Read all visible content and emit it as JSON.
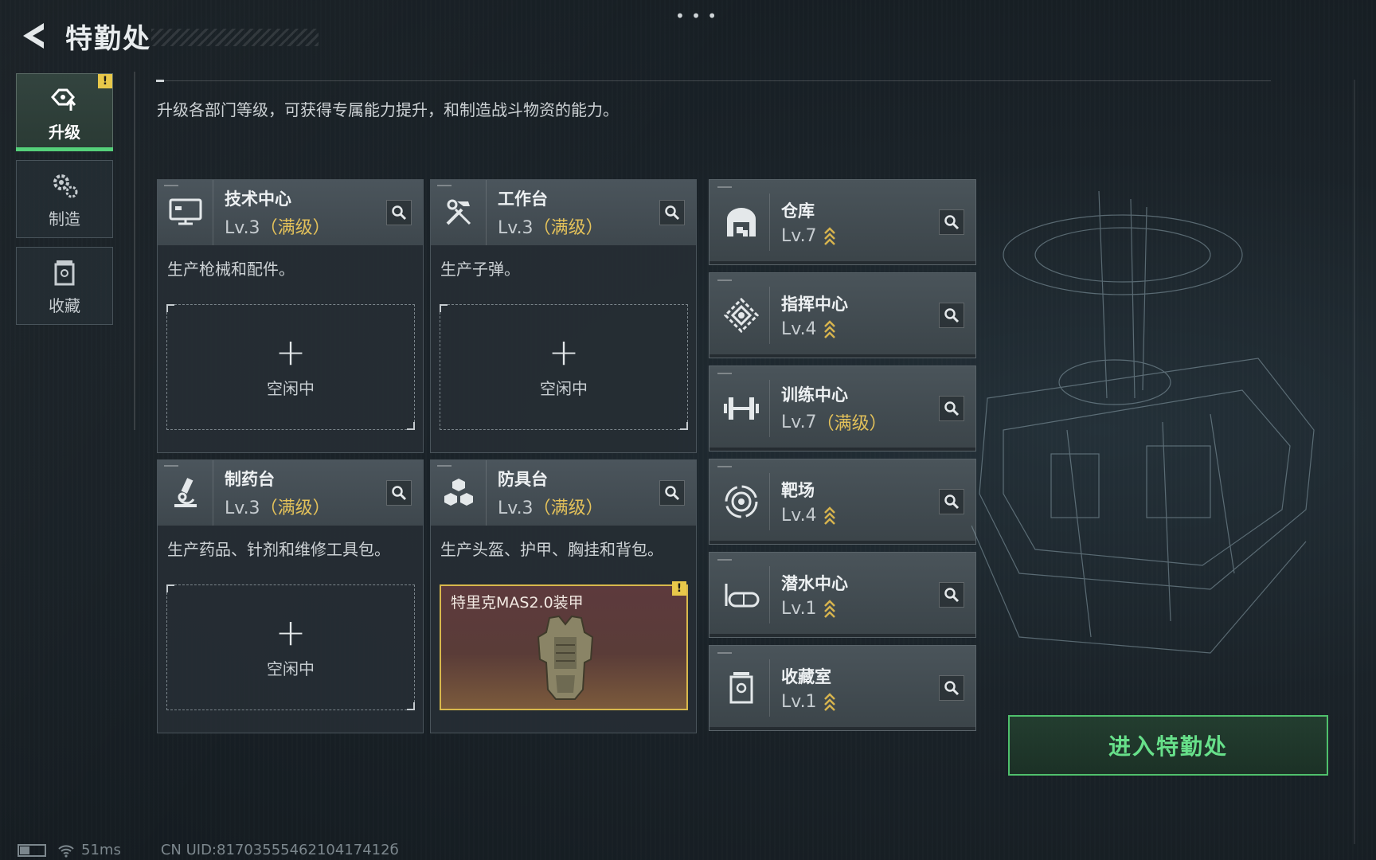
{
  "header": {
    "title": "特勤处"
  },
  "side_nav": [
    {
      "label": "升级",
      "icon": "upgrade-icon",
      "active": true,
      "badge": "!"
    },
    {
      "label": "制造",
      "icon": "gears-icon",
      "active": false
    },
    {
      "label": "收藏",
      "icon": "collection-icon",
      "active": false
    }
  ],
  "description": "升级各部门等级，可获得专属能力提升，和制造战斗物资的能力。",
  "workshops": [
    {
      "name": "技术中心",
      "level": "Lv.3",
      "max": "（满级）",
      "desc": "生产枪械和配件。",
      "slot_label": "空闲中",
      "icon": "computer-icon"
    },
    {
      "name": "工作台",
      "level": "Lv.3",
      "max": "（满级）",
      "desc": "生产子弹。",
      "slot_label": "空闲中",
      "icon": "tools-icon"
    },
    {
      "name": "制药台",
      "level": "Lv.3",
      "max": "（满级）",
      "desc": "生产药品、针剂和维修工具包。",
      "slot_label": "空闲中",
      "icon": "microscope-icon"
    },
    {
      "name": "防具台",
      "level": "Lv.3",
      "max": "（满级）",
      "desc": "生产头盔、护甲、胸挂和背包。",
      "item_name": "特里克MAS2.0装甲",
      "item_badge": "!",
      "icon": "cubes-icon"
    }
  ],
  "facilities": [
    {
      "name": "仓库",
      "level": "Lv.7",
      "max": "",
      "icon": "warehouse-icon"
    },
    {
      "name": "指挥中心",
      "level": "Lv.4",
      "max": "",
      "icon": "command-icon"
    },
    {
      "name": "训练中心",
      "level": "Lv.7",
      "max": "（满级）",
      "icon": "dumbbell-icon"
    },
    {
      "name": "靶场",
      "level": "Lv.4",
      "max": "",
      "icon": "target-icon"
    },
    {
      "name": "潜水中心",
      "level": "Lv.1",
      "max": "",
      "icon": "goggles-icon"
    },
    {
      "name": "收藏室",
      "level": "Lv.1",
      "max": "",
      "icon": "collection-icon"
    }
  ],
  "enter_button": "进入特勤处",
  "footer": {
    "ping": "51ms",
    "uid": "CN UID:8170355546210417412б"
  },
  "colors": {
    "accent_green": "#4fc06c",
    "max_gold": "#e3c15a",
    "warning": "#e8c84a"
  }
}
